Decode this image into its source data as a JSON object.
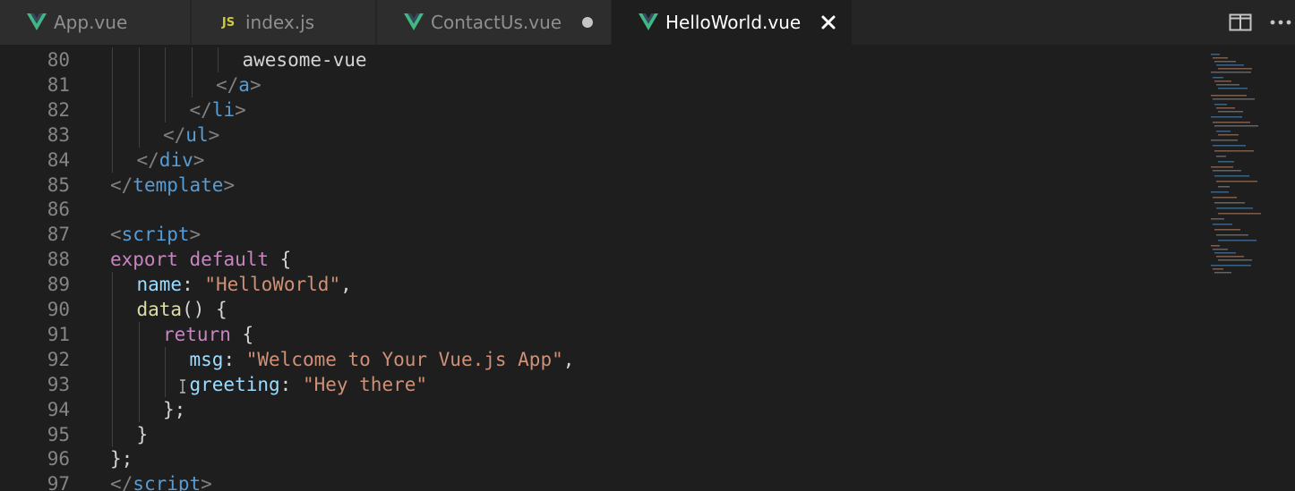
{
  "tabs": [
    {
      "label": "App.vue",
      "icon": "vue-icon",
      "active": false,
      "dirty": false
    },
    {
      "label": "index.js",
      "icon": "js-icon",
      "icon_text": "JS",
      "active": false,
      "dirty": false
    },
    {
      "label": "ContactUs.vue",
      "icon": "vue-icon",
      "active": false,
      "dirty": true
    },
    {
      "label": "HelloWorld.vue",
      "icon": "vue-icon",
      "active": true,
      "dirty": false
    }
  ],
  "editor_actions": [
    "split-editor-icon",
    "more-actions-icon"
  ],
  "colors": {
    "vue": "#41b883",
    "js": "#cbcb41",
    "tag": "#569cd6",
    "keyword": "#c586c0",
    "property": "#9cdcfe",
    "string": "#ce9178",
    "function": "#dcdcaa",
    "line_number": "#858585"
  },
  "lines": [
    {
      "n": "80",
      "indent": 5,
      "tokens": [
        {
          "t": "awesome-vue",
          "c": ""
        }
      ]
    },
    {
      "n": "81",
      "indent": 4,
      "tokens": [
        {
          "t": "</",
          "c": "br"
        },
        {
          "t": "a",
          "c": "tag"
        },
        {
          "t": ">",
          "c": "br"
        }
      ]
    },
    {
      "n": "82",
      "indent": 3,
      "tokens": [
        {
          "t": "</",
          "c": "br"
        },
        {
          "t": "li",
          "c": "tag"
        },
        {
          "t": ">",
          "c": "br"
        }
      ]
    },
    {
      "n": "83",
      "indent": 2,
      "tokens": [
        {
          "t": "</",
          "c": "br"
        },
        {
          "t": "ul",
          "c": "tag"
        },
        {
          "t": ">",
          "c": "br"
        }
      ]
    },
    {
      "n": "84",
      "indent": 1,
      "tokens": [
        {
          "t": "</",
          "c": "br"
        },
        {
          "t": "div",
          "c": "tag"
        },
        {
          "t": ">",
          "c": "br"
        }
      ]
    },
    {
      "n": "85",
      "indent": 0,
      "tokens": [
        {
          "t": "</",
          "c": "br"
        },
        {
          "t": "template",
          "c": "tag"
        },
        {
          "t": ">",
          "c": "br"
        }
      ]
    },
    {
      "n": "86",
      "indent": 0,
      "tokens": []
    },
    {
      "n": "87",
      "indent": 0,
      "tokens": [
        {
          "t": "<",
          "c": "br"
        },
        {
          "t": "script",
          "c": "tag"
        },
        {
          "t": ">",
          "c": "br"
        }
      ]
    },
    {
      "n": "88",
      "indent": 0,
      "tokens": [
        {
          "t": "export",
          "c": "kw"
        },
        {
          "t": " ",
          "c": ""
        },
        {
          "t": "default",
          "c": "kw"
        },
        {
          "t": " {",
          "c": ""
        }
      ]
    },
    {
      "n": "89",
      "indent": 1,
      "tokens": [
        {
          "t": "name",
          "c": "prop"
        },
        {
          "t": ": ",
          "c": ""
        },
        {
          "t": "\"HelloWorld\"",
          "c": "str"
        },
        {
          "t": ",",
          "c": ""
        }
      ]
    },
    {
      "n": "90",
      "indent": 1,
      "tokens": [
        {
          "t": "data",
          "c": "fn"
        },
        {
          "t": "() {",
          "c": ""
        }
      ]
    },
    {
      "n": "91",
      "indent": 2,
      "tokens": [
        {
          "t": "return",
          "c": "kw"
        },
        {
          "t": " {",
          "c": ""
        }
      ]
    },
    {
      "n": "92",
      "indent": 3,
      "tokens": [
        {
          "t": "msg",
          "c": "prop"
        },
        {
          "t": ": ",
          "c": ""
        },
        {
          "t": "\"Welcome to Your Vue.js App\"",
          "c": "str"
        },
        {
          "t": ",",
          "c": ""
        }
      ]
    },
    {
      "n": "93",
      "indent": 3,
      "tokens": [
        {
          "t": "greeting",
          "c": "prop"
        },
        {
          "t": ": ",
          "c": ""
        },
        {
          "t": "\"Hey there\"",
          "c": "str"
        }
      ]
    },
    {
      "n": "94",
      "indent": 2,
      "tokens": [
        {
          "t": "};",
          "c": ""
        }
      ]
    },
    {
      "n": "95",
      "indent": 1,
      "tokens": [
        {
          "t": "}",
          "c": ""
        }
      ]
    },
    {
      "n": "96",
      "indent": 0,
      "tokens": [
        {
          "t": "};",
          "c": ""
        }
      ]
    },
    {
      "n": "97",
      "indent": 0,
      "tokens": [
        {
          "t": "</",
          "c": "br"
        },
        {
          "t": "script",
          "c": "tag"
        },
        {
          "t": ">",
          "c": "br"
        }
      ]
    }
  ]
}
